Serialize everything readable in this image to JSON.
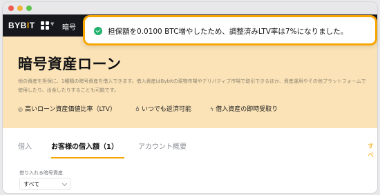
{
  "window": {
    "controls": [
      "close",
      "minimize",
      "maximize"
    ]
  },
  "navbar": {
    "logo_main": "BYB",
    "logo_accent": "I",
    "logo_end": "T",
    "apps_icon": "grid-icon",
    "link": "暗号"
  },
  "toast": {
    "icon": "check-circle-icon",
    "message": "担保額を0.0100 BTC増やしたため、調整済みLTV率は7%になりました。",
    "colors": {
      "border": "#f7a600",
      "icon": "#20b26c"
    }
  },
  "hero": {
    "title": "暗号資産ローン",
    "description": "他の資産を担保に、1種類の暗号資産を借入できます。借入資産はBybitの現物市場やデリバティブ市場で取引できるほか、資産運用やその他プラットフォームで使用したり、出金したりすることも可能です。",
    "features": [
      {
        "icon": "check-circle-icon",
        "label": "高いローン資産価値比率（LTV）"
      },
      {
        "icon": "piggy-bank-icon",
        "label": "いつでも返済可能"
      },
      {
        "icon": "lightning-icon",
        "label": "借入資産の即時受取り"
      }
    ],
    "background": "#fbe3b7"
  },
  "tabs": {
    "items": [
      {
        "label": "借入",
        "active": false
      },
      {
        "label": "お客様の借入額（1）",
        "active": true
      },
      {
        "label": "アカウント概要",
        "active": false
      }
    ],
    "more": "すべ",
    "accent": "#f7a600"
  },
  "filter": {
    "label": "借り入れる暗号資産",
    "selected": "すべて"
  }
}
